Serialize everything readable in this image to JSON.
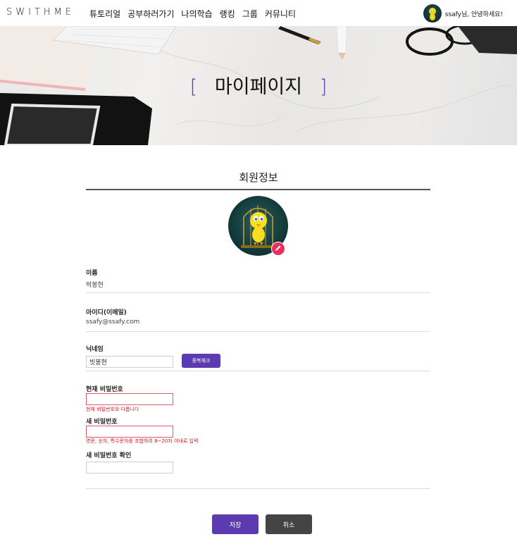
{
  "nav": {
    "logo": "SWITHME",
    "menu": [
      "튜토리얼",
      "공부하러가기",
      "나의학습",
      "랭킹",
      "그룹",
      "커뮤니티"
    ],
    "greeting": "ssafy님, 안녕하세요!"
  },
  "banner": {
    "bracket_left": "[",
    "title": "마이페이지",
    "bracket_right": "]"
  },
  "profile_section": {
    "title": "회원정보"
  },
  "fields": {
    "name_label": "이름",
    "name_value": "박봉현",
    "id_label": "아이디(이메일)",
    "id_value": "ssafy@ssafy.com",
    "nickname_label": "닉네임",
    "nickname_value": "빗봉현",
    "dup_check_label": "중복체크",
    "current_pw_label": "현재 비밀번호",
    "current_pw_error": "현재 비밀번호와 다릅니다",
    "new_pw_label": "새 비밀번호",
    "new_pw_error": "영문, 숫자, 특수문자를 조합하여 8~20자 이내로 입력",
    "confirm_pw_label": "새 비밀번호 확인"
  },
  "actions": {
    "save": "저장",
    "cancel": "취소"
  },
  "colors": {
    "accent": "#5c3bb2",
    "error": "#d01a2a",
    "cancel": "#444444",
    "edit_badge": "#e8305e"
  },
  "icons": {
    "edit": "pencil-icon",
    "avatar": "tweety-avatar"
  }
}
